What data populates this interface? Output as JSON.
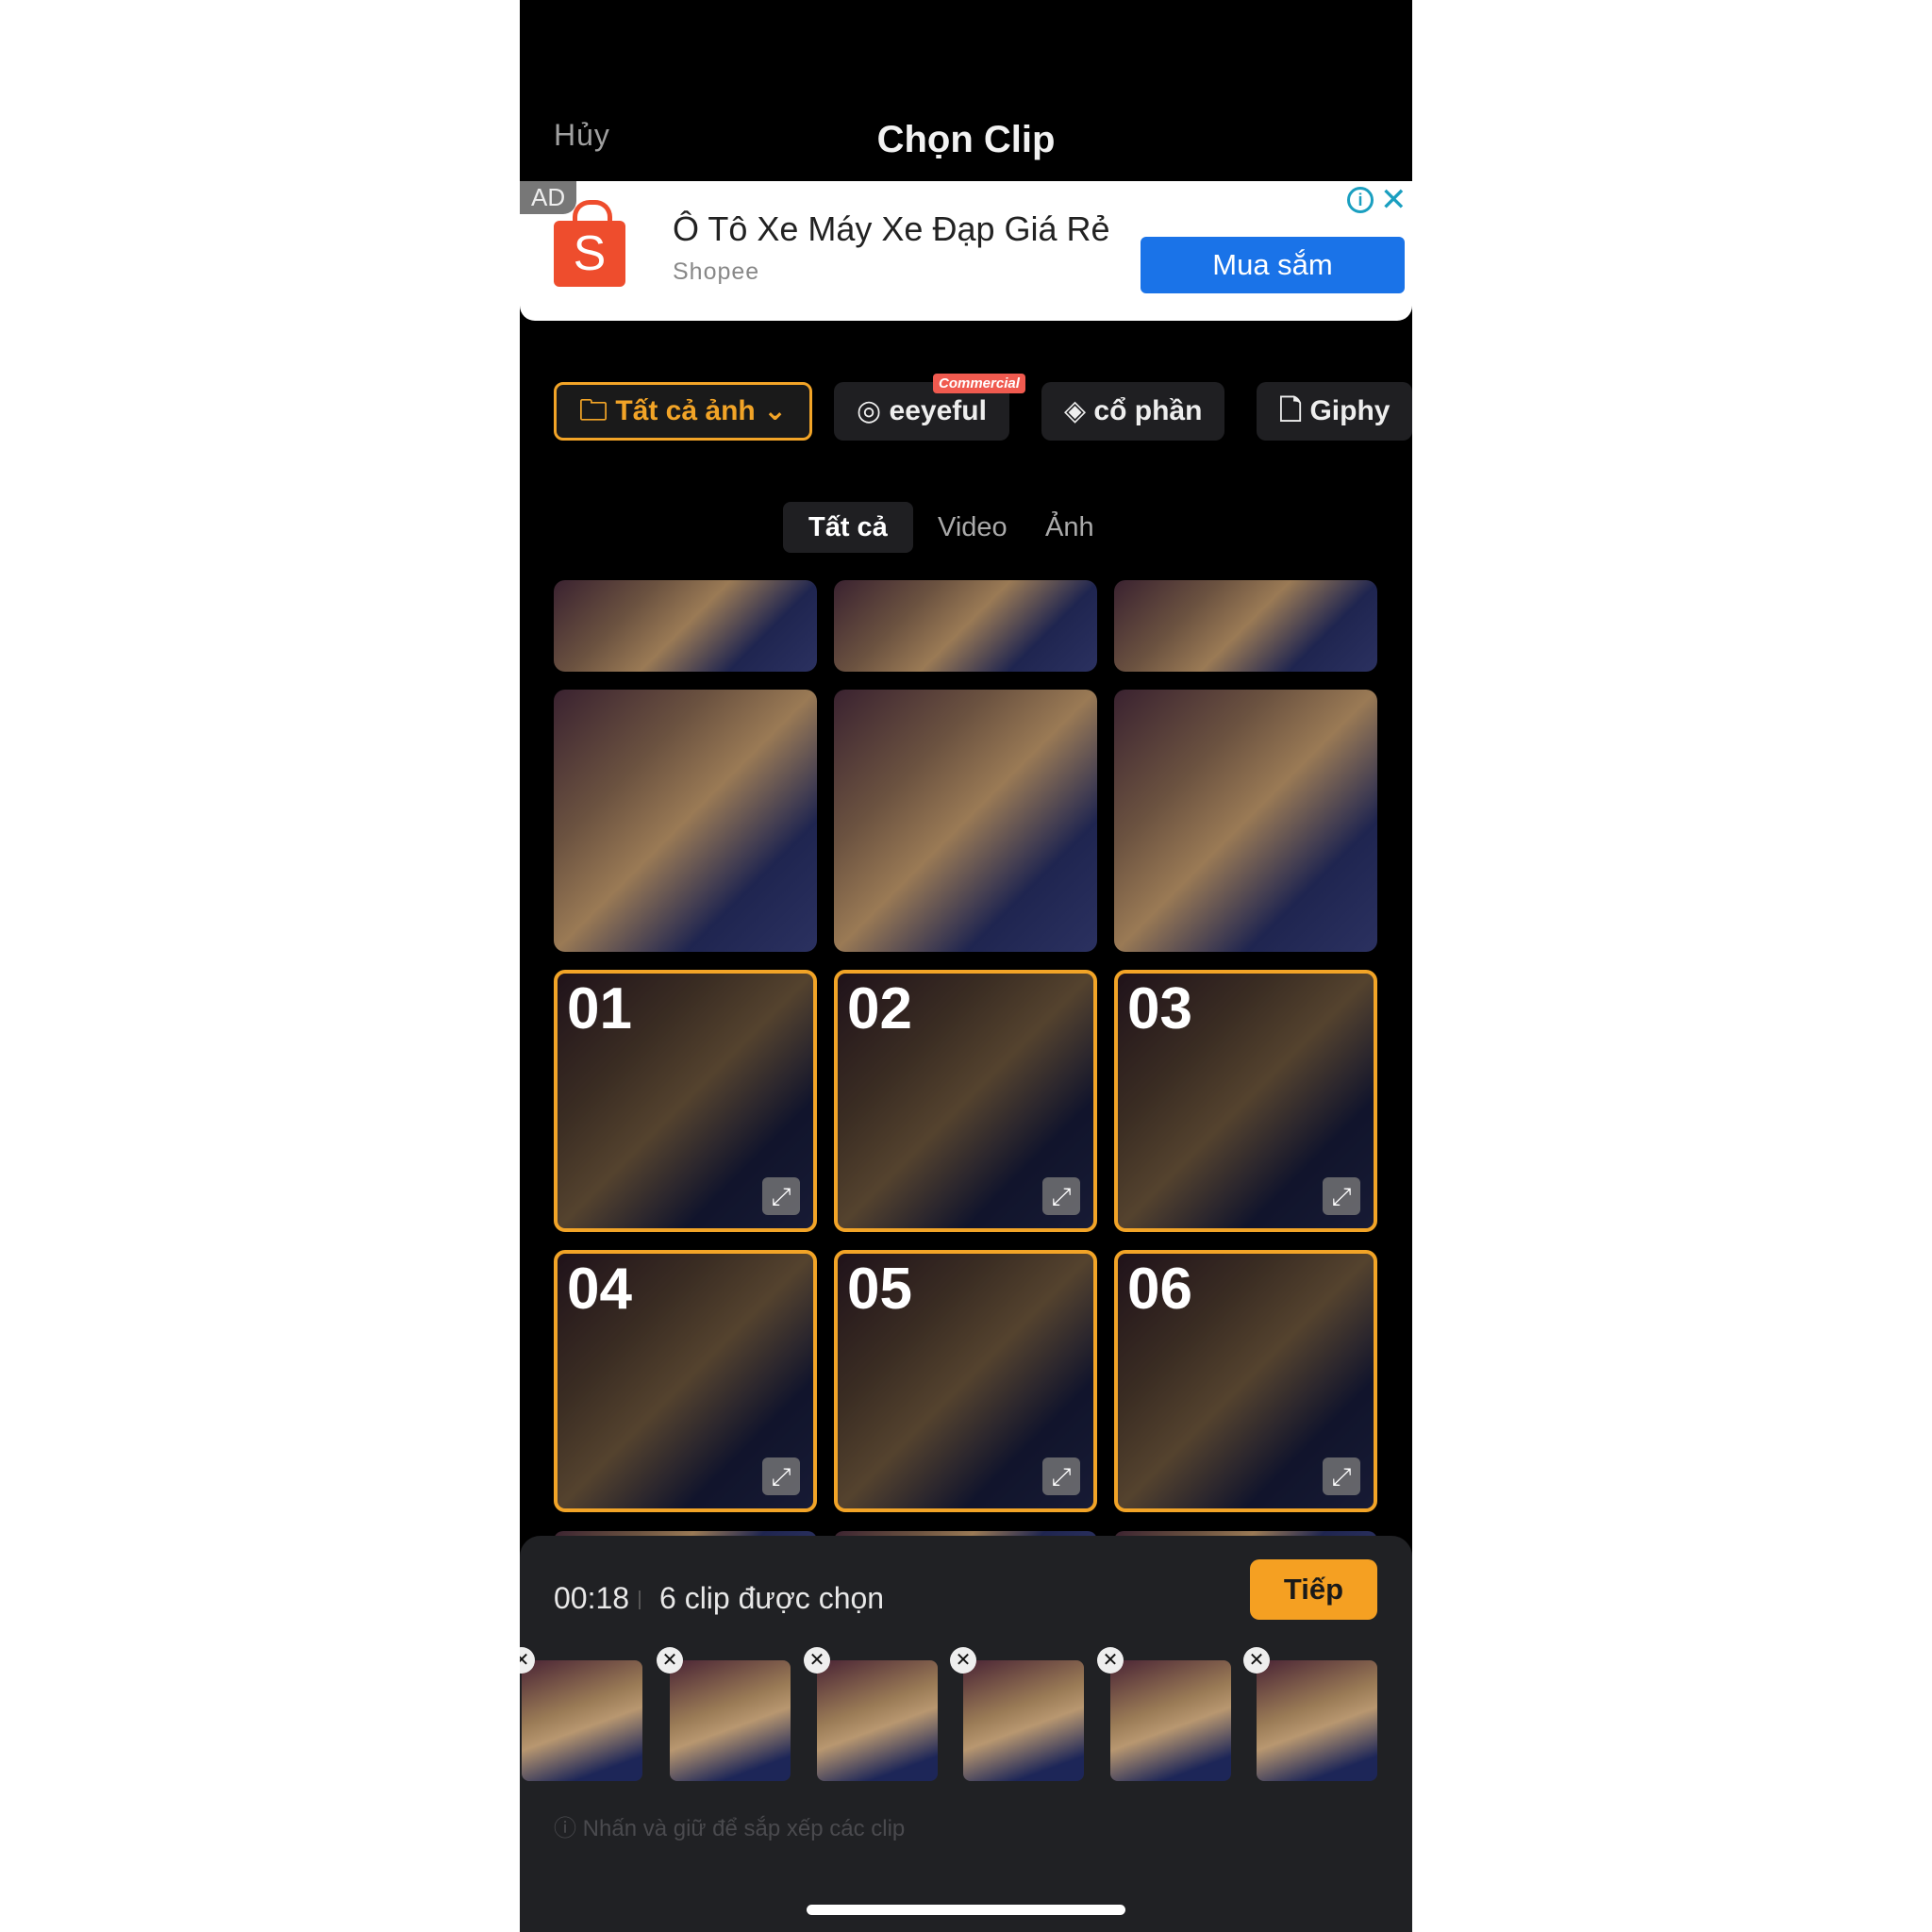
{
  "header": {
    "cancel": "Hủy",
    "title": "Chọn Clip"
  },
  "ad": {
    "tag": "AD",
    "title": "Ô Tô Xe Máy Xe Đạp Giá Rẻ",
    "advertiser": "Shopee",
    "cta": "Mua sắm",
    "logo_letter": "S"
  },
  "sources": [
    {
      "label": "Tất cả ảnh"
    },
    {
      "label": "eeyeful",
      "badge": "Commercial"
    },
    {
      "label": "cổ phần"
    },
    {
      "label": "Giphy"
    }
  ],
  "tabs": [
    "Tất cả",
    "Video",
    "Ảnh"
  ],
  "selected_numbers": [
    "01",
    "02",
    "03",
    "04",
    "05",
    "06"
  ],
  "footer": {
    "duration": "00:18",
    "count": "6 clip được chọn",
    "next": "Tiếp",
    "hint": "Nhấn và giữ để sắp xếp các clip"
  },
  "colors": {
    "accent": "#f5a022",
    "ad_button": "#1a73e8",
    "badge": "#f05a4f"
  }
}
